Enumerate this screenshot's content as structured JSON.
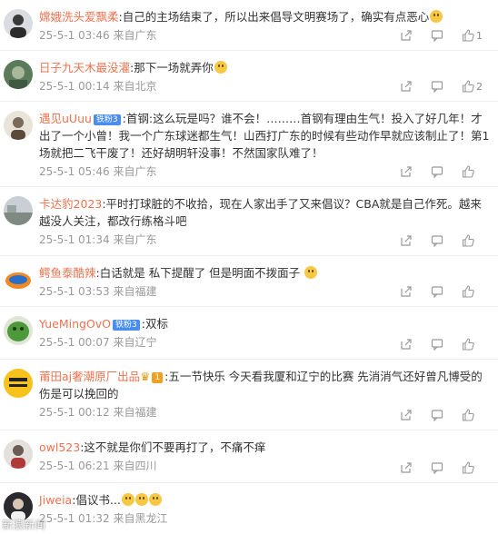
{
  "comments": [
    {
      "user": "嫦娥洗头爱飘柔",
      "badge": "",
      "text": "自己的主场结束了，所以出来倡导文明赛场了，确实有点恶心",
      "emoji": 1,
      "date": "25-5-1 03:46",
      "location": "来自广东",
      "likes": "1"
    },
    {
      "user": "日子九天木最没灌",
      "badge": "",
      "text": "那下一场就弄你",
      "emoji": 1,
      "date": "25-5-1 00:14",
      "location": "来自北京",
      "likes": "2"
    },
    {
      "user": "遇见uUuu",
      "badge": "铁粉3",
      "text": "首钢:这么玩是吗？谁不会！………首钢有理由生气！投入了好几年！才出了一个小曾！我一个广东球迷都生气！山西打广东的时候有些动作早就应该制止了！第1场就把二飞干废了！还好胡明轩没事！不然国家队难了！",
      "emoji": 0,
      "date": "25-5-1 05:46",
      "location": "来自广东",
      "likes": ""
    },
    {
      "user": "卡达豹2023",
      "badge": "",
      "text": "平时打球脏的不收拾，现在人家出手了又来倡议？CBA就是自己作死。越来越没人关注，都改行练格斗吧",
      "emoji": 0,
      "date": "25-5-1 01:34",
      "location": "来自广东",
      "likes": ""
    },
    {
      "user": "鳄鱼泰酷辣",
      "badge": "",
      "text": "白话就是 私下提醒了 但是明面不拨面子",
      "emoji": 1,
      "date": "25-5-1 03:53",
      "location": "来自福建",
      "likes": ""
    },
    {
      "user": "YueMingOvO",
      "badge": "铁粉3",
      "text": "双标",
      "emoji": 0,
      "date": "25-5-1 00:07",
      "location": "来自辽宁",
      "likes": ""
    },
    {
      "user": "莆田aj奢潮原厂出品",
      "badge": "1",
      "text": "五一节快乐 今天看我厦和辽宁的比赛 先消消气还好曾凡博受的伤是可以挽回的",
      "emoji": 0,
      "date": "25-5-1 00:12",
      "location": "来自福建",
      "likes": ""
    },
    {
      "user": "owl523",
      "badge": "",
      "text": "这不就是你们不要再打了，不痛不痒",
      "emoji": 0,
      "date": "25-5-1 06:21",
      "location": "来自四川",
      "likes": ""
    },
    {
      "user": "Jiweia",
      "badge": "",
      "text": "倡议书...",
      "emoji": 3,
      "date": "25-5-1 01:32",
      "location": "来自黑龙江",
      "likes": ""
    }
  ],
  "watermark": "新浪新闻"
}
